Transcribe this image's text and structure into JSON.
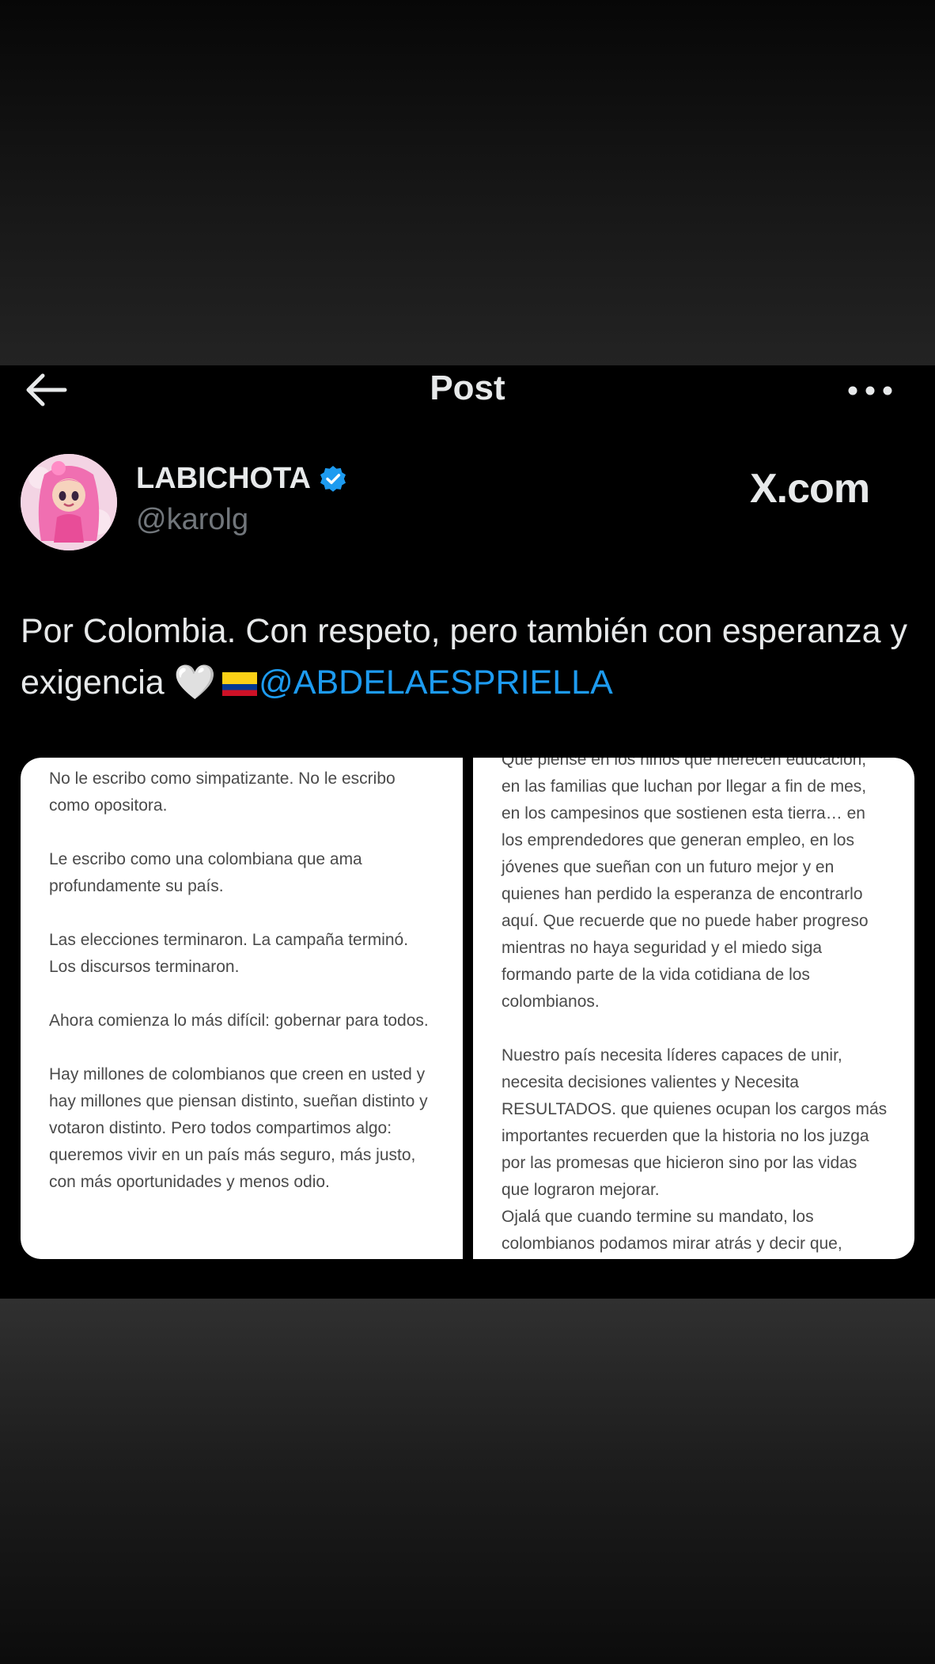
{
  "header": {
    "title": "Post",
    "back_icon": "back-arrow-icon",
    "more_icon": "more-options-icon"
  },
  "author": {
    "display_name": "LABICHOTA",
    "handle": "@karolg",
    "verified": true,
    "verified_color": "#1d9bf0",
    "watermark": "X.com"
  },
  "tweet": {
    "text": "Por Colombia. Con respeto, pero también con esperanza y exigencia 🤍",
    "mention": "@ABDELAESPRIELLA"
  },
  "media": {
    "left_paragraphs": [
      "No le escribo como simpatizante. No le escribo como opositora.",
      "Le escribo como una colombiana que ama profundamente su país.",
      "Las elecciones terminaron. La campaña terminó. Los discursos terminaron.",
      "Ahora comienza lo más difícil: gobernar para todos.",
      "Hay millones de colombianos que creen en usted y hay millones que piensan distinto, sueñan distinto y votaron distinto. Pero todos compartimos algo: queremos vivir en un país más seguro, más justo, con más oportunidades y menos odio."
    ],
    "right_paragraphs": [
      "Que piense en los niños que merecen educación, en las familias que luchan por llegar a fin de mes, en los campesinos que sostienen esta tierra… en los emprendedores que generan empleo, en los jóvenes que sueñan con un futuro mejor y en quienes han perdido la esperanza de encontrarlo aquí. Que recuerde que no puede haber progreso mientras no haya seguridad y el miedo siga formando parte de la vida cotidiana de los colombianos.",
      "Nuestro país  necesita líderes capaces de unir, necesita decisiones valientes y Necesita RESULTADOS. que quienes ocupan los cargos más importantes recuerden que la historia no los juzga por las promesas que hicieron sino por las vidas que lograron mejorar.",
      "Ojalá que cuando termine su mandato, los colombianos podamos mirar atrás y decir que,"
    ]
  },
  "colors": {
    "post_background": "#000000",
    "text_primary": "#e7e9ea",
    "text_secondary": "#71767b",
    "link": "#1d9bf0"
  }
}
